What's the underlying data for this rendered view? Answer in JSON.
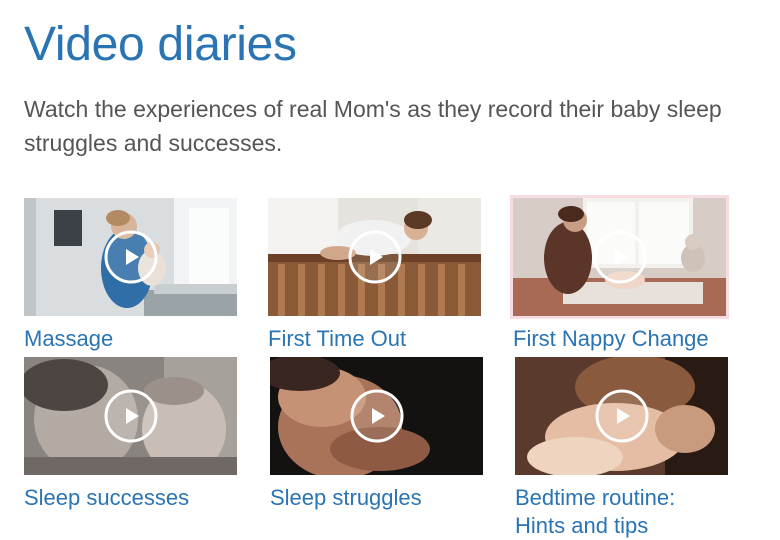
{
  "header": {
    "title": "Video diaries",
    "intro": "Watch the experiences of real Mom's as they record their baby sleep struggles and successes."
  },
  "videos": [
    {
      "title": "Massage",
      "icon": "play-icon"
    },
    {
      "title": "First Time Out",
      "icon": "play-icon"
    },
    {
      "title": "First Nappy Change",
      "icon": "play-icon"
    },
    {
      "title": "Sleep successes",
      "icon": "play-icon"
    },
    {
      "title": "Sleep struggles",
      "icon": "play-icon"
    },
    {
      "title": "Bedtime routine: Hints and tips",
      "icon": "play-icon"
    }
  ],
  "colors": {
    "link": "#2a74b4",
    "body_text": "#555555",
    "highlight_border": "#f7dce1"
  }
}
